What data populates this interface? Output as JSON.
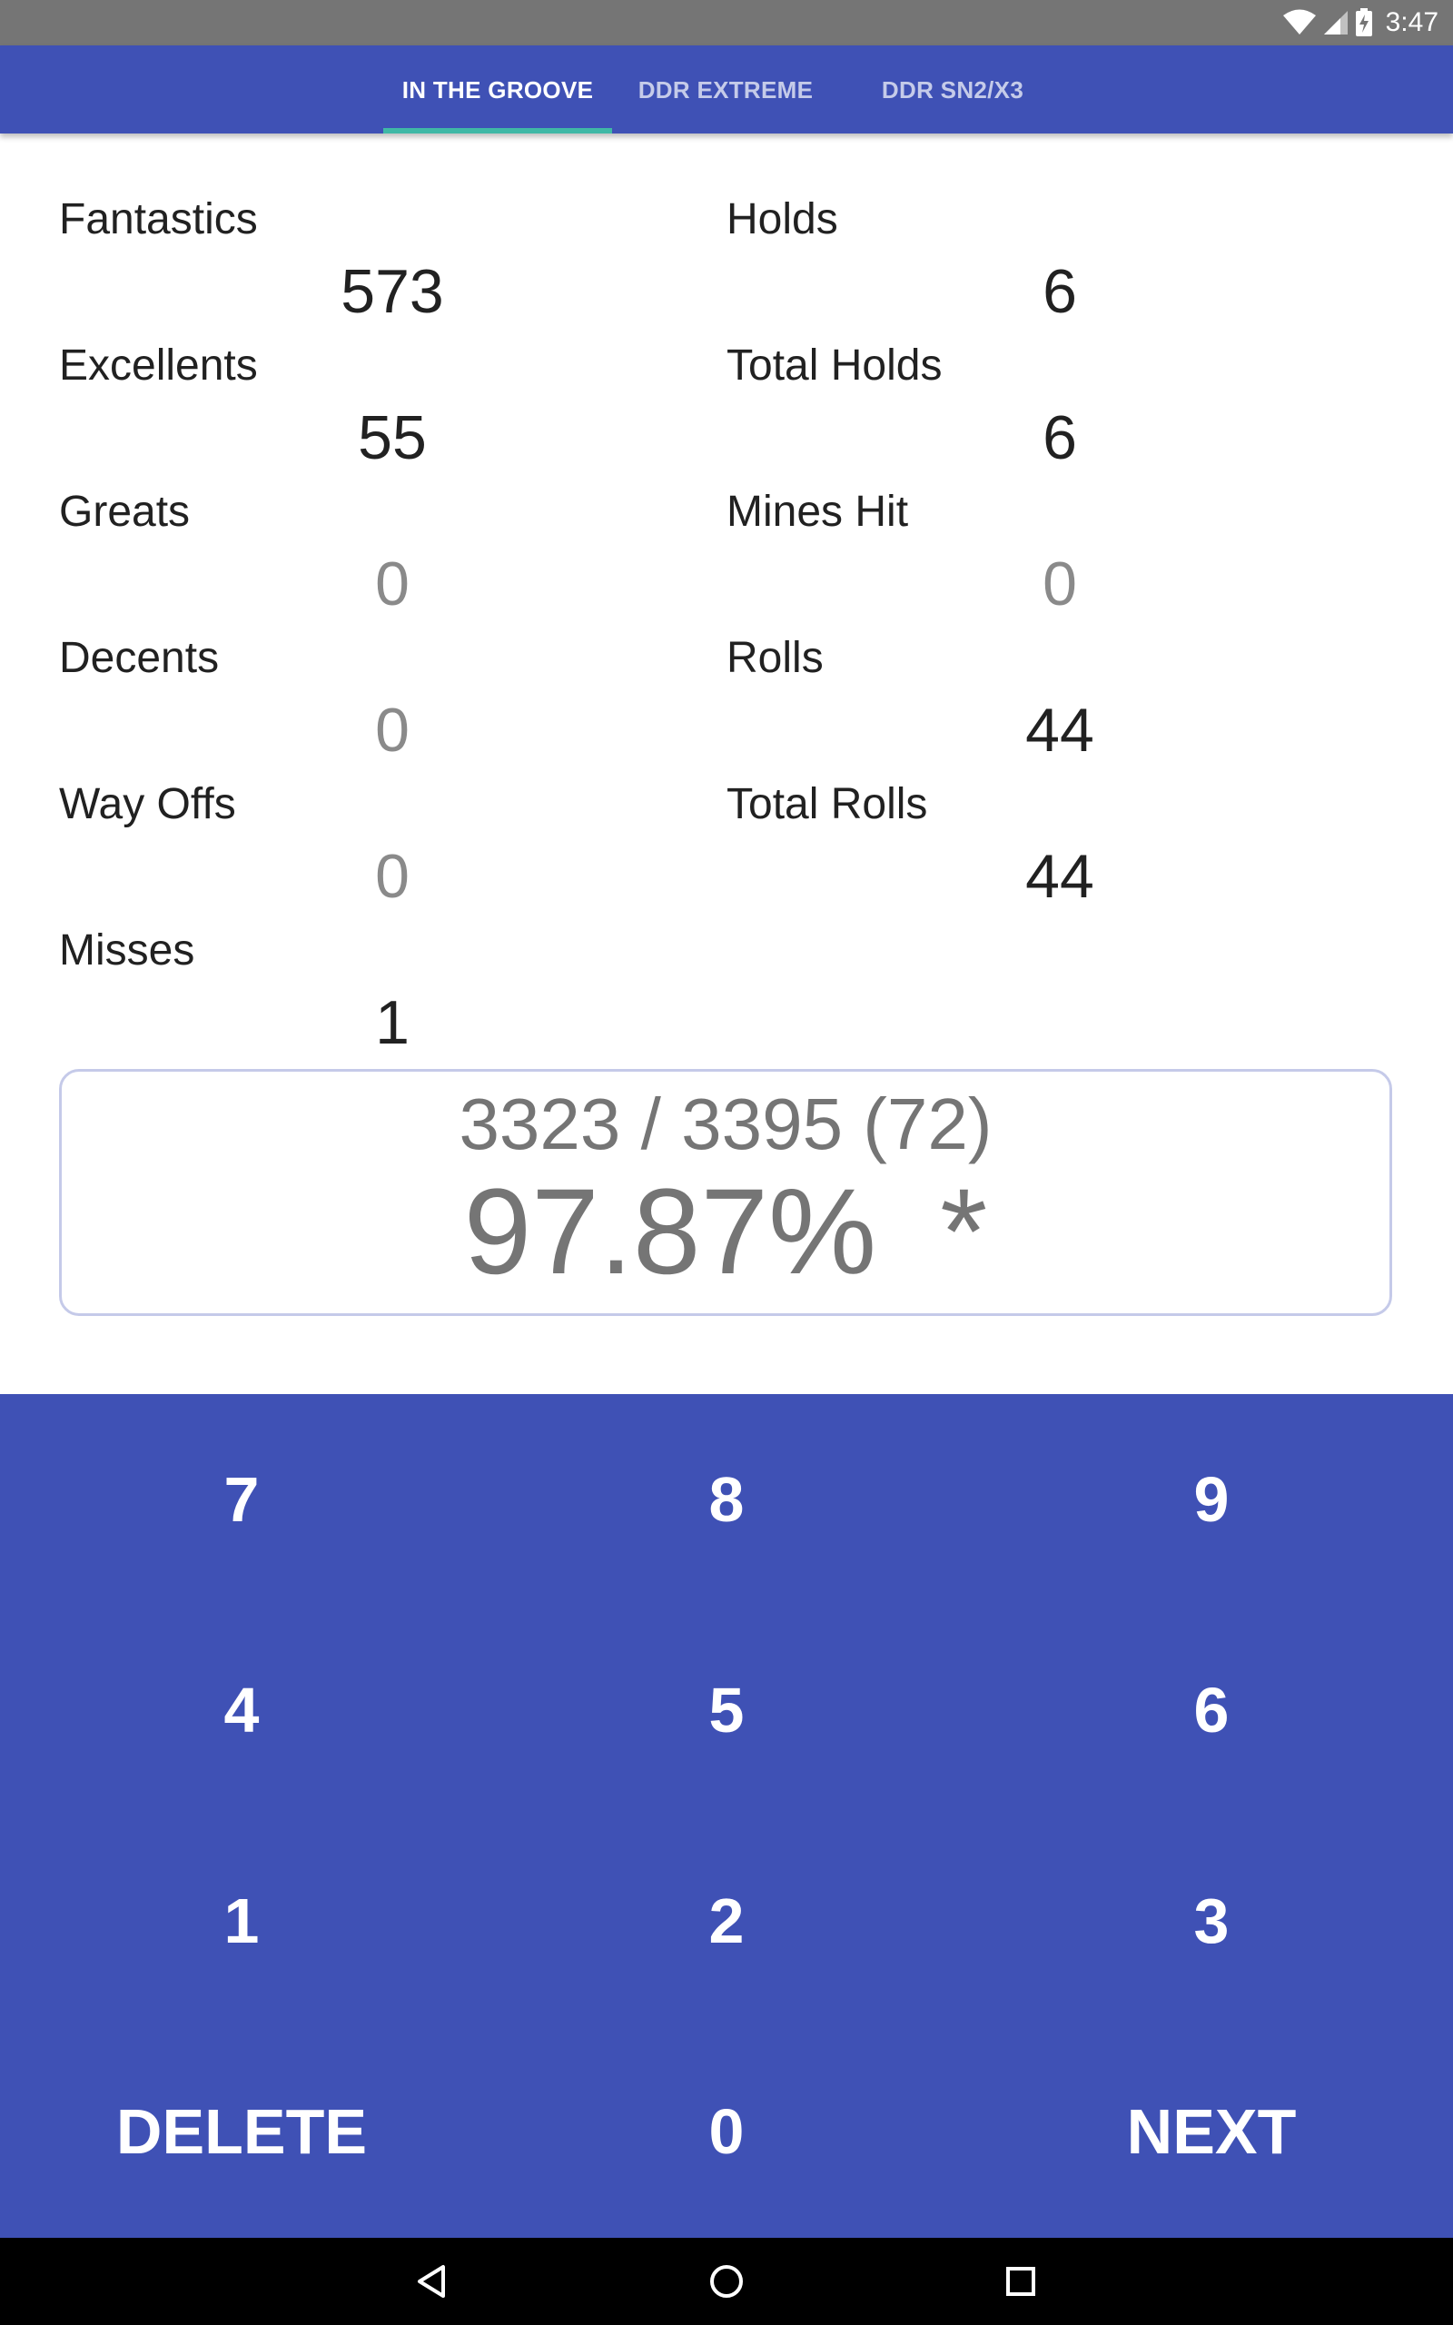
{
  "status_bar": {
    "time": "3:47",
    "icons": [
      "wifi-icon",
      "cellular-signal-icon",
      "battery-charging-icon"
    ]
  },
  "tabs": [
    {
      "label": "IN THE GROOVE",
      "active": true
    },
    {
      "label": "DDR EXTREME",
      "active": false
    },
    {
      "label": "DDR SN2/X3",
      "active": false
    }
  ],
  "stats_left": [
    {
      "label": "Fantastics",
      "value": "573"
    },
    {
      "label": "Excellents",
      "value": "55"
    },
    {
      "label": "Greats",
      "value": "0"
    },
    {
      "label": "Decents",
      "value": "0"
    },
    {
      "label": "Way Offs",
      "value": "0"
    },
    {
      "label": "Misses",
      "value": "1"
    }
  ],
  "stats_right": [
    {
      "label": "Holds",
      "value": "6"
    },
    {
      "label": "Total Holds",
      "value": "6"
    },
    {
      "label": "Mines Hit",
      "value": "0"
    },
    {
      "label": "Rolls",
      "value": "44"
    },
    {
      "label": "Total Rolls",
      "value": "44"
    }
  ],
  "score": {
    "points": "3323 / 3395 (72)",
    "percent": "97.87%",
    "grade": "*"
  },
  "keypad": {
    "keys": [
      "7",
      "8",
      "9",
      "4",
      "5",
      "6",
      "1",
      "2",
      "3"
    ],
    "delete_label": "DELETE",
    "zero_label": "0",
    "next_label": "NEXT"
  },
  "navigation_bar": {
    "icons": [
      "back-icon",
      "home-icon",
      "recents-icon"
    ]
  },
  "colors": {
    "primary": "#3f51b5",
    "tab_indicator": "#3fb8a6",
    "score_border": "#c5cae9",
    "zero_value": "#8a8a8a"
  }
}
